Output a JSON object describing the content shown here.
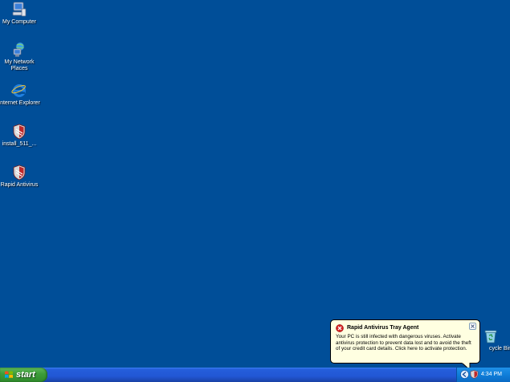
{
  "desktop": {
    "background_color": "#004e98",
    "icons": [
      {
        "label": "My Computer",
        "icon": "my-computer-icon"
      },
      {
        "label": "My Network Places",
        "icon": "network-places-icon"
      },
      {
        "label": "Internet Explorer",
        "icon": "internet-explorer-icon"
      },
      {
        "label": "install_511_...",
        "icon": "installer-shield-icon"
      },
      {
        "label": "Rapid Antivirus",
        "icon": "rapid-antivirus-icon"
      },
      {
        "label": "cycle Bin",
        "icon": "recycle-bin-icon"
      }
    ]
  },
  "taskbar": {
    "start_label": "start",
    "clock": "4:34 PM",
    "tray_icons": [
      "blue-arrow-icon",
      "rapid-antivirus-tray-icon"
    ]
  },
  "balloon": {
    "title": "Rapid Antivirus Tray Agent",
    "body": "Your PC is still infected with dangerous viruses. Activate antivirus protection to prevent data lost and to avoid the theft of your credit card details. Click here to activate protection.",
    "icon": "error-icon"
  }
}
